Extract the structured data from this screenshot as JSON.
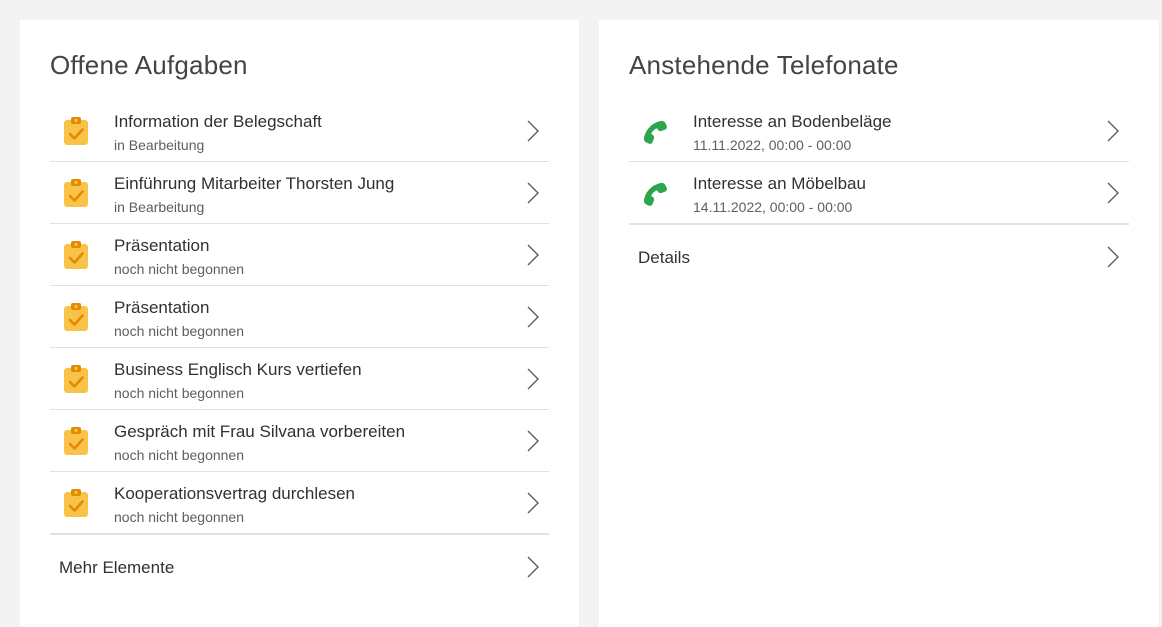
{
  "colors": {
    "task_icon": "#f9c34a",
    "task_check": "#e58a00",
    "phone_icon": "#2da44e",
    "divider": "#e1e1e1"
  },
  "tasks_panel": {
    "title": "Offene Aufgaben",
    "icon": "clipboard-check-icon",
    "items": [
      {
        "title": "Information der Belegschaft",
        "status": "in Bearbeitung"
      },
      {
        "title": "Einführung Mitarbeiter Thorsten Jung",
        "status": "in Bearbeitung"
      },
      {
        "title": "Präsentation",
        "status": "noch nicht begonnen"
      },
      {
        "title": "Präsentation",
        "status": "noch nicht begonnen"
      },
      {
        "title": "Business Englisch Kurs vertiefen",
        "status": "noch nicht begonnen"
      },
      {
        "title": "Gespräch mit Frau Silvana vorbereiten",
        "status": "noch nicht begonnen"
      },
      {
        "title": "Kooperationsvertrag durchlesen",
        "status": "noch nicht begonnen"
      }
    ],
    "more_label": "Mehr Elemente"
  },
  "calls_panel": {
    "title": "Anstehende Telefonate",
    "icon": "phone-icon",
    "items": [
      {
        "title": "Interesse an Bodenbeläge",
        "time": "11.11.2022, 00:00 - 00:00"
      },
      {
        "title": "Interesse an Möbelbau",
        "time": "14.11.2022, 00:00 - 00:00"
      }
    ],
    "more_label": "Details"
  }
}
